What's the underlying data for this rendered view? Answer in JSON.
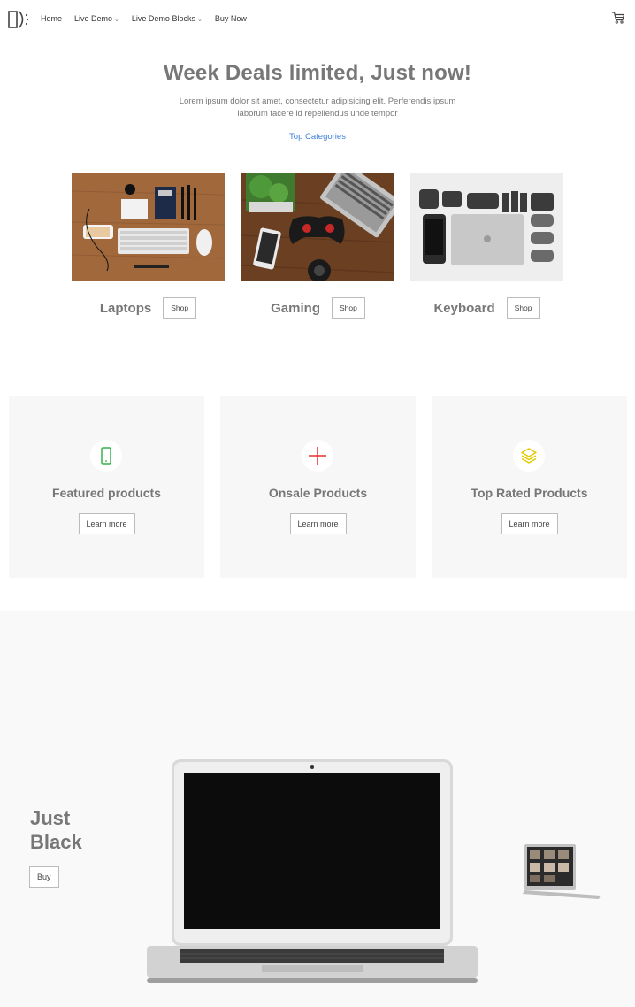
{
  "nav": {
    "items": [
      {
        "label": "Home",
        "has_caret": false
      },
      {
        "label": "Live Demo",
        "has_caret": true
      },
      {
        "label": "Live Demo Blocks",
        "has_caret": true
      },
      {
        "label": "Buy Now",
        "has_caret": false
      }
    ],
    "cart_icon": "cart-icon",
    "logo_icon": "logo-icon"
  },
  "hero": {
    "title": "Week Deals limited, Just now!",
    "subtitle": "Lorem ipsum dolor sit amet, consectetur adipisicing elit. Perferendis ipsum laborum facere id repellendus unde tempor",
    "link": "Top Categories"
  },
  "categories": [
    {
      "name": "Laptops",
      "button": "Shop"
    },
    {
      "name": "Gaming",
      "button": "Shop"
    },
    {
      "name": "Keyboard",
      "button": "Shop"
    }
  ],
  "features": [
    {
      "title": "Featured products",
      "button": "Learn more",
      "icon": "phone-icon",
      "color": "#36b24a"
    },
    {
      "title": "Onsale Products",
      "button": "Learn more",
      "icon": "plus-icon",
      "color": "#e0302a"
    },
    {
      "title": "Top Rated Products",
      "button": "Learn more",
      "icon": "layers-icon",
      "color": "#f0d500"
    }
  ],
  "banner": {
    "title_line1": "Just",
    "title_line2": "Black",
    "button": "Buy"
  },
  "colors": {
    "link": "#3d7fd8",
    "heading": "#777777",
    "panel": "#f7f7f7"
  }
}
